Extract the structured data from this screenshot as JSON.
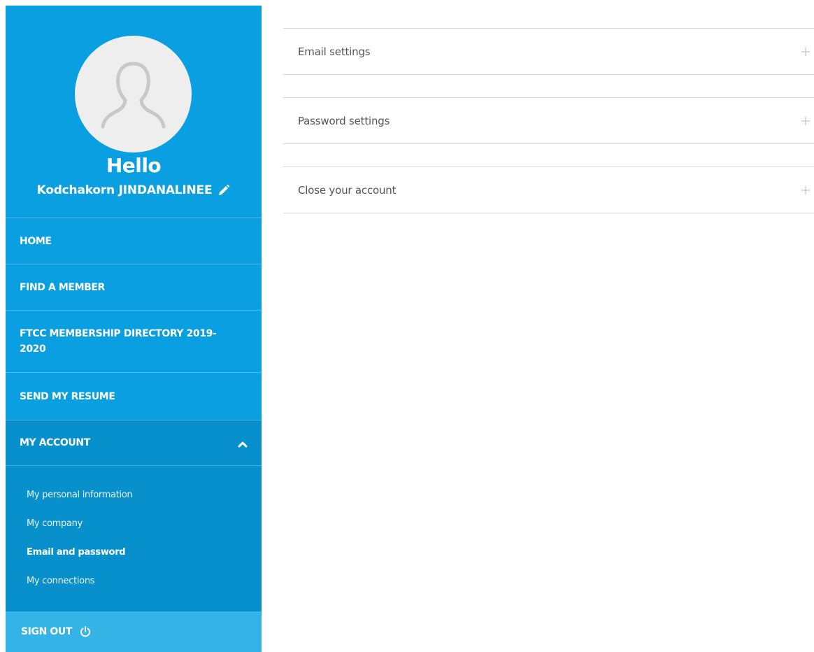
{
  "profile": {
    "greeting": "Hello",
    "user_name": "Kodchakorn JINDANALINEE",
    "avatar_icon": "user-placeholder-icon",
    "edit_icon": "pencil-icon"
  },
  "nav": {
    "home": "HOME",
    "find_member": "FIND A MEMBER",
    "directory": "FTCC MEMBERSHIP DIRECTORY 2019-2020",
    "send_resume": "SEND MY RESUME",
    "my_account": "MY ACCOUNT",
    "my_account_icon": "chevron-up-icon",
    "submenu": [
      {
        "label": "My personal information",
        "active": false
      },
      {
        "label": "My company",
        "active": false
      },
      {
        "label": "Email and password",
        "active": true
      },
      {
        "label": "My connections",
        "active": false
      }
    ],
    "sign_out": "SIGN OUT",
    "sign_out_icon": "power-icon"
  },
  "panels": [
    {
      "label": "Email settings",
      "icon": "plus-icon"
    },
    {
      "label": "Password settings",
      "icon": "plus-icon"
    },
    {
      "label": "Close your account",
      "icon": "plus-icon"
    }
  ],
  "colors": {
    "sidebar_bg": "#0a9fe0",
    "account_bg": "#0890cc",
    "signout_bg": "#33b3e6",
    "panel_border": "#d6d6d6",
    "panel_text": "#555555"
  }
}
